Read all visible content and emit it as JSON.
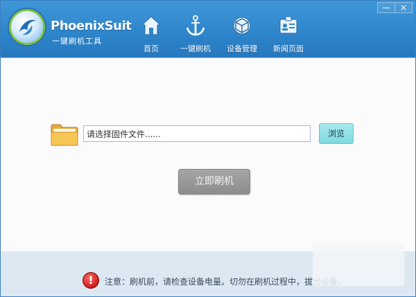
{
  "app": {
    "brand": "PhoenixSuit",
    "subtitle": "一键刷机工具"
  },
  "window_controls": {
    "minimize": "—",
    "close": "×"
  },
  "nav": [
    {
      "label": "首页",
      "icon": "home-icon"
    },
    {
      "label": "一键刷机",
      "icon": "anchor-icon"
    },
    {
      "label": "设备管理",
      "icon": "device-cube-icon"
    },
    {
      "label": "新闻页面",
      "icon": "news-id-card-icon"
    }
  ],
  "main": {
    "file_input_value": "请选择固件文件......",
    "browse_label": "浏览",
    "flash_label": "立即刷机"
  },
  "footer": {
    "notice": "注意：刷机前，请检查设备电量。切勿在刷机过程中，拔出设备。"
  },
  "colors": {
    "header": "#2f86cb",
    "browse": "#7dd9df",
    "flash": "#969696",
    "footer": "#dce9f3",
    "warning": "#cc1b1b"
  }
}
